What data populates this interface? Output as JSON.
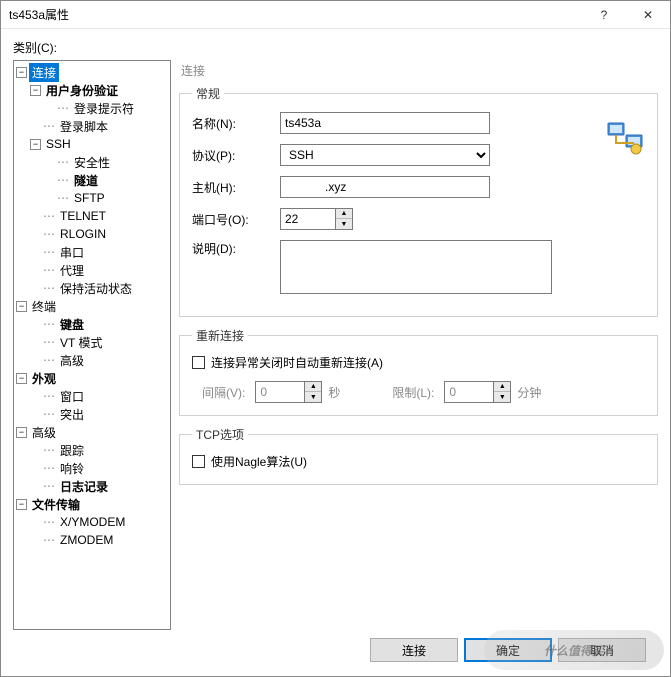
{
  "titlebar": {
    "title": "ts453a属性",
    "help": "?",
    "close": "✕"
  },
  "category_label": "类别(C):",
  "tree": {
    "connection": "连接",
    "user_auth": "用户身份验证",
    "login_prompt": "登录提示符",
    "login_script": "登录脚本",
    "ssh": "SSH",
    "security": "安全性",
    "tunnel": "隧道",
    "sftp": "SFTP",
    "telnet": "TELNET",
    "rlogin": "RLOGIN",
    "serial": "串口",
    "proxy": "代理",
    "keepalive": "保持活动状态",
    "terminal": "终端",
    "keyboard": "键盘",
    "vt_mode": "VT 模式",
    "advanced_t": "高级",
    "appearance": "外观",
    "window": "窗口",
    "highlight": "突出",
    "advanced": "高级",
    "trace": "跟踪",
    "bell": "响铃",
    "log": "日志记录",
    "file_transfer": "文件传输",
    "xymodem": "X/YMODEM",
    "zmodem": "ZMODEM"
  },
  "right": {
    "section_title": "连接",
    "general_legend": "常规",
    "name_label": "名称(N):",
    "name_value": "ts453a",
    "protocol_label": "协议(P):",
    "protocol_value": "SSH",
    "host_label": "主机(H):",
    "host_value": "            .xyz",
    "port_label": "端口号(O):",
    "port_value": "22",
    "desc_label": "说明(D):",
    "desc_value": "",
    "reconnect_legend": "重新连接",
    "reconnect_chk": "连接异常关闭时自动重新连接(A)",
    "interval_label": "间隔(V):",
    "interval_value": "0",
    "seconds": "秒",
    "limit_label": "限制(L):",
    "limit_value": "0",
    "minutes": "分钟",
    "tcp_legend": "TCP选项",
    "nagle_chk": "使用Nagle算法(U)"
  },
  "footer": {
    "connect": "连接",
    "ok": "确定",
    "cancel": "取消"
  },
  "watermark": "什么值得买",
  "glyphs": {
    "up": "▲",
    "dn": "▼",
    "minus": "−",
    "plus": "+",
    "dots": "⋯"
  }
}
